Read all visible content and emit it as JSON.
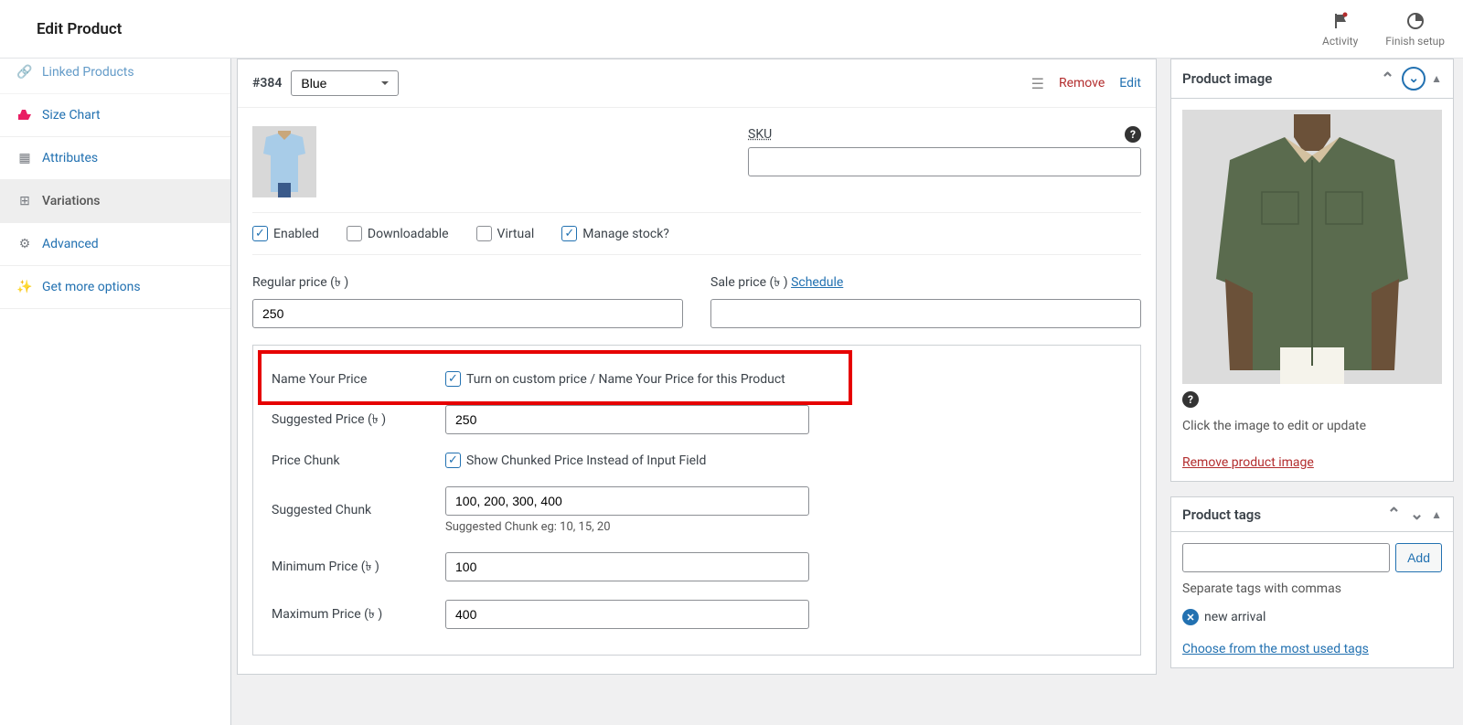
{
  "header": {
    "title": "Edit Product",
    "activity_label": "Activity",
    "finish_label": "Finish setup"
  },
  "sidebar": {
    "items": [
      {
        "label": "Linked Products"
      },
      {
        "label": "Size Chart"
      },
      {
        "label": "Attributes"
      },
      {
        "label": "Variations"
      },
      {
        "label": "Advanced"
      },
      {
        "label": "Get more options"
      }
    ]
  },
  "variation": {
    "id": "#384",
    "select_value": "Blue",
    "remove": "Remove",
    "edit": "Edit",
    "sku_label": "SKU",
    "sku_value": "",
    "checkboxes": {
      "enabled": "Enabled",
      "downloadable": "Downloadable",
      "virtual": "Virtual",
      "manage_stock": "Manage stock?"
    },
    "regular_price_label": "Regular price (৳ )",
    "regular_price_value": "250",
    "sale_price_label": "Sale price (৳ )",
    "sale_price_value": "",
    "schedule": "Schedule"
  },
  "nyp": {
    "section_label": "Name Your Price",
    "enable_label": "Turn on custom price / Name Your Price for this Product",
    "suggested_price_label": "Suggested Price (৳ )",
    "suggested_price_value": "250",
    "price_chunk_label": "Price Chunk",
    "chunk_checkbox_label": "Show Chunked Price Instead of Input Field",
    "suggested_chunk_label": "Suggested Chunk",
    "suggested_chunk_value": "100, 200, 300, 400",
    "suggested_chunk_hint": "Suggested Chunk eg: 10, 15, 20",
    "min_price_label": "Minimum Price (৳ )",
    "min_price_value": "100",
    "max_price_label": "Maximum Price (৳ )",
    "max_price_value": "400"
  },
  "product_image": {
    "title": "Product image",
    "caption": "Click the image to edit or update",
    "remove": "Remove product image"
  },
  "product_tags": {
    "title": "Product tags",
    "add": "Add",
    "hint": "Separate tags with commas",
    "tag": "new arrival",
    "choose": "Choose from the most used tags"
  }
}
